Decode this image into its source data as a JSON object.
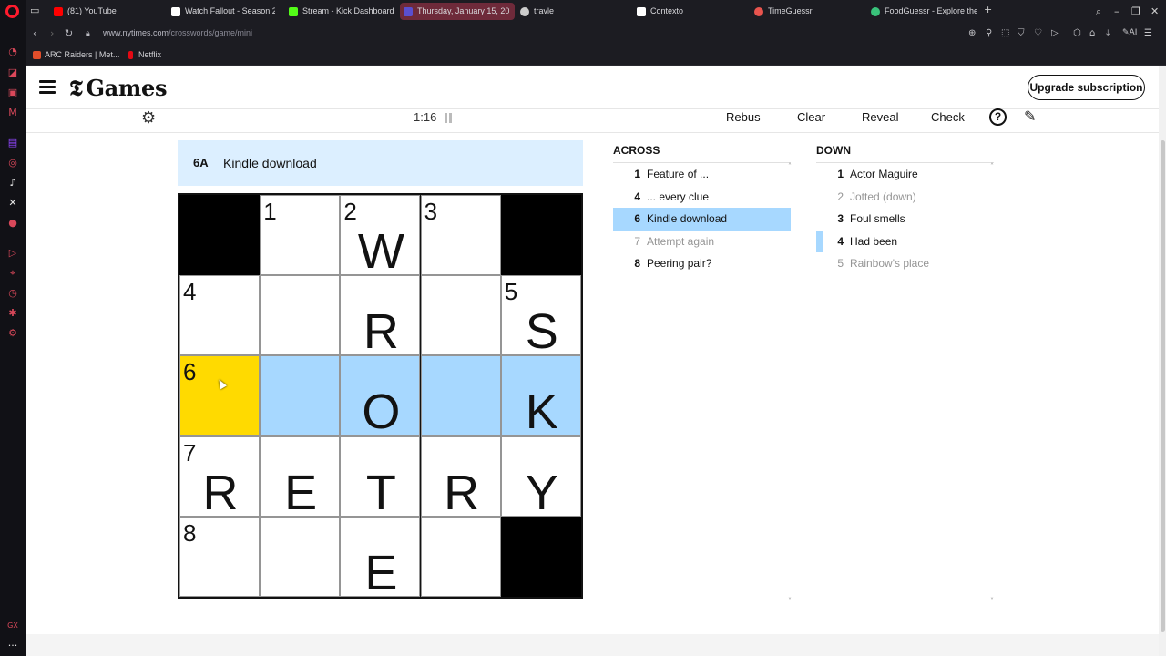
{
  "tabs": [
    {
      "label": "(81) YouTube",
      "color": "#ff0000"
    },
    {
      "label": "Watch Fallout - Season 2 |",
      "color": "#ffffff"
    },
    {
      "label": "Stream - Kick Dashboard",
      "color": "#53fc18"
    },
    {
      "label": "Thursday, January 15, 20",
      "color": "#5a4fcf"
    },
    {
      "label": "travle",
      "color": "#cccccc"
    },
    {
      "label": "Contexto",
      "color": "#ffffff"
    },
    {
      "label": "TimeGuessr",
      "color": "#e8544e"
    },
    {
      "label": "FoodGuessr - Explore the",
      "color": "#39c27a"
    }
  ],
  "url": {
    "host": "www.nytimes.com",
    "path": "/crosswords/game/mini"
  },
  "bookmarks": [
    {
      "label": "ARC Raiders | Met...",
      "color": "#e04e2b"
    },
    {
      "label": "Netflix",
      "color": "#e50914"
    }
  ],
  "header": {
    "logo": "Games",
    "upgrade": "Upgrade subscription"
  },
  "toolbar": {
    "timer": "1:16",
    "rebus": "Rebus",
    "clear": "Clear",
    "reveal": "Reveal",
    "check": "Check",
    "help": "?"
  },
  "clue_bar": {
    "number": "6A",
    "text": "Kindle download"
  },
  "grid": [
    [
      {
        "block": true
      },
      {
        "n": "1",
        "l": ""
      },
      {
        "n": "2",
        "l": "W"
      },
      {
        "n": "3",
        "l": ""
      },
      {
        "block": true
      }
    ],
    [
      {
        "n": "4",
        "l": ""
      },
      {
        "n": "",
        "l": ""
      },
      {
        "n": "",
        "l": "R"
      },
      {
        "n": "",
        "l": ""
      },
      {
        "n": "5",
        "l": "S"
      }
    ],
    [
      {
        "n": "6",
        "l": "",
        "state": "sel"
      },
      {
        "n": "",
        "l": "",
        "state": "hl"
      },
      {
        "n": "",
        "l": "O",
        "state": "hl"
      },
      {
        "n": "",
        "l": "",
        "state": "hl"
      },
      {
        "n": "",
        "l": "K",
        "state": "hl"
      }
    ],
    [
      {
        "n": "7",
        "l": "R"
      },
      {
        "n": "",
        "l": "E"
      },
      {
        "n": "",
        "l": "T"
      },
      {
        "n": "",
        "l": "R"
      },
      {
        "n": "",
        "l": "Y"
      }
    ],
    [
      {
        "n": "8",
        "l": ""
      },
      {
        "n": "",
        "l": ""
      },
      {
        "n": "",
        "l": "E"
      },
      {
        "n": "",
        "l": ""
      },
      {
        "block": true
      }
    ]
  ],
  "across": {
    "title": "ACROSS",
    "clues": [
      {
        "n": "1",
        "t": "Feature of ..."
      },
      {
        "n": "4",
        "t": "... every clue"
      },
      {
        "n": "6",
        "t": "Kindle download",
        "state": "hl"
      },
      {
        "n": "7",
        "t": "Attempt again",
        "state": "done"
      },
      {
        "n": "8",
        "t": "Peering pair?"
      }
    ]
  },
  "down": {
    "title": "DOWN",
    "clues": [
      {
        "n": "1",
        "t": "Actor Maguire"
      },
      {
        "n": "2",
        "t": "Jotted (down)",
        "state": "done"
      },
      {
        "n": "3",
        "t": "Foul smells"
      },
      {
        "n": "4",
        "t": "Had been",
        "state": "mark"
      },
      {
        "n": "5",
        "t": "Rainbow's place",
        "state": "done"
      }
    ]
  }
}
